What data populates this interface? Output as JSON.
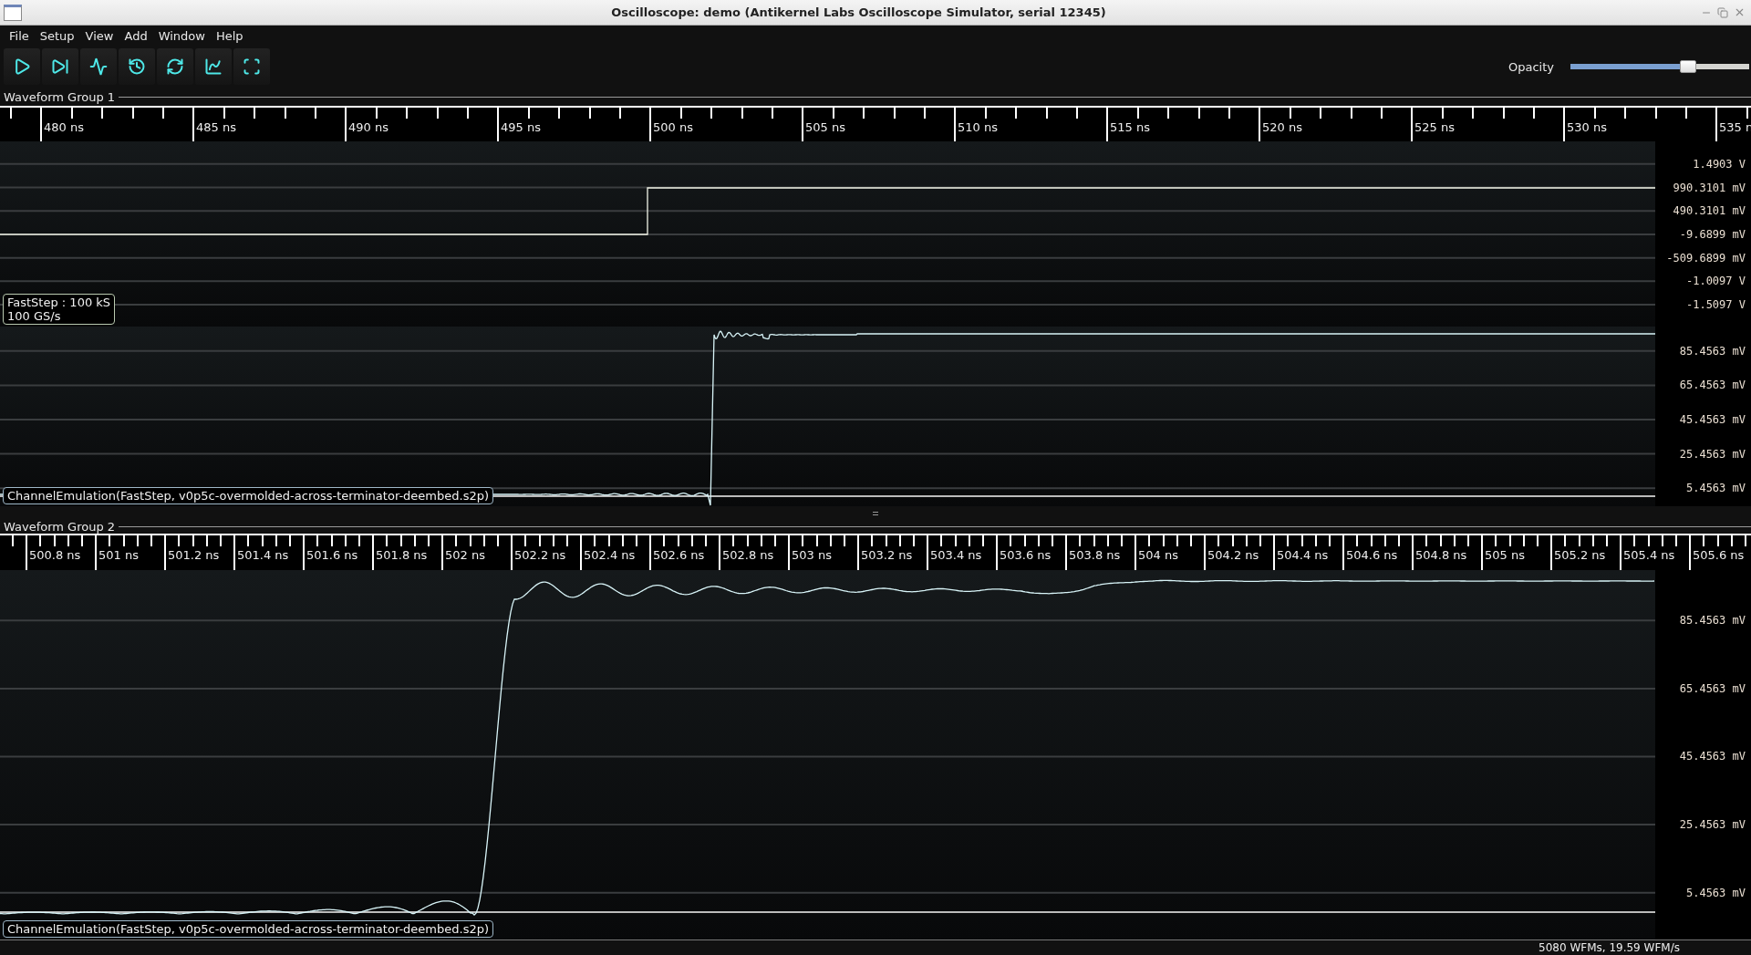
{
  "window": {
    "title": "Oscilloscope: demo (Antikernel Labs Oscilloscope Simulator, serial 12345)"
  },
  "menu": [
    "File",
    "Setup",
    "View",
    "Add",
    "Window",
    "Help"
  ],
  "toolbar": [
    {
      "kind": "start"
    },
    {
      "kind": "single"
    },
    {
      "kind": "waveform"
    },
    {
      "kind": "history"
    },
    {
      "kind": "refresh"
    },
    {
      "kind": "plot"
    },
    {
      "kind": "fullscreen"
    }
  ],
  "opacity": {
    "label": "Opacity",
    "level": 0.66
  },
  "groups": [
    {
      "title": "Waveform Group 1",
      "time_labels": [
        "480 ns",
        "485 ns",
        "490 ns",
        "495 ns",
        "500 ns",
        "505 ns",
        "510 ns",
        "515 ns",
        "520 ns",
        "525 ns",
        "530 ns",
        "535 n"
      ],
      "channels": [
        {
          "kind": "step",
          "axis_labels": [
            "1.4903 V",
            "990.3101 mV",
            "490.3101 mV",
            "-9.6899 mV",
            "-509.6899 mV",
            "-1.0097 V",
            "-1.5097 V"
          ],
          "label_lines": [
            "FastStep : 100 kS",
            "100 GS/s"
          ]
        },
        {
          "kind": "edge",
          "axis_labels": [
            "85.4563 mV",
            "65.4563 mV",
            "45.4563 mV",
            "25.4563 mV",
            "5.4563 mV"
          ],
          "label_lines": [
            "ChannelEmulation(FastStep, v0p5c-overmolded-across-terminator-deembed.s2p)"
          ]
        }
      ]
    },
    {
      "title": "Waveform Group 2",
      "time_labels": [
        "500.8 ns",
        "501 ns",
        "501.2 ns",
        "501.4 ns",
        "501.6 ns",
        "501.8 ns",
        "502 ns",
        "502.2 ns",
        "502.4 ns",
        "502.6 ns",
        "502.8 ns",
        "503 ns",
        "503.2 ns",
        "503.4 ns",
        "503.6 ns",
        "503.8 ns",
        "504 ns",
        "504.2 ns",
        "504.4 ns",
        "504.6 ns",
        "504.8 ns",
        "505 ns",
        "505.2 ns",
        "505.4 ns",
        "505.6 ns"
      ],
      "channels": [
        {
          "kind": "zoomed",
          "axis_labels": [
            "85.4563 mV",
            "65.4563 mV",
            "45.4563 mV",
            "25.4563 mV",
            "5.4563 mV"
          ],
          "label_lines": [
            "ChannelEmulation(FastStep, v0p5c-overmolded-across-terminator-deembed.s2p)"
          ]
        }
      ]
    }
  ],
  "status_bar": "5080 WFMs, 19.59 WFM/s"
}
